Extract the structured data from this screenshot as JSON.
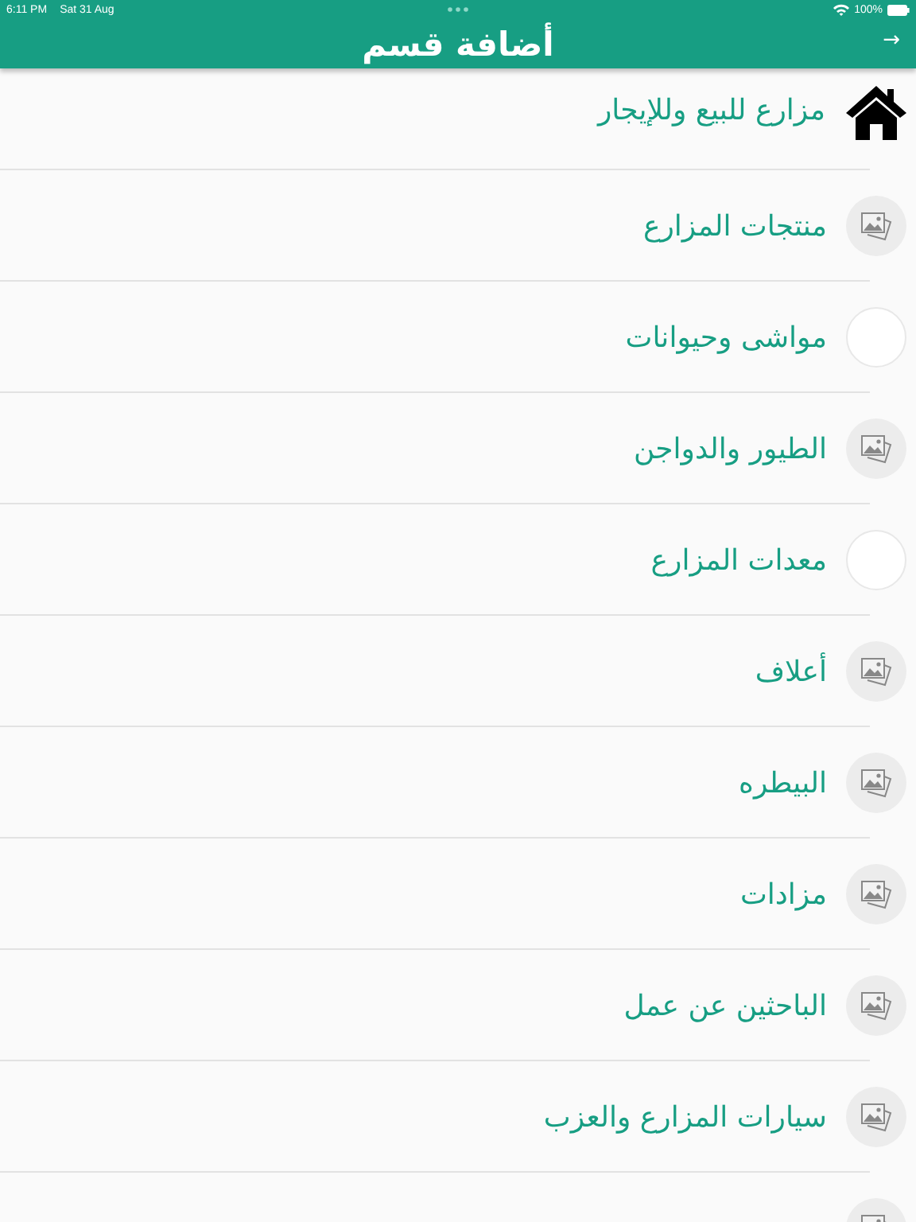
{
  "status_bar": {
    "time": "6:11 PM",
    "date": "Sat 31 Aug",
    "battery": "100%"
  },
  "header": {
    "title": "أضافة قسم",
    "back": "→"
  },
  "categories": [
    {
      "label": "مزارع للبيع وللإيجار",
      "kind": "home"
    },
    {
      "label": "منتجات المزارع",
      "kind": "image"
    },
    {
      "label": "مواشى وحيوانات",
      "kind": "blank"
    },
    {
      "label": "الطيور والدواجن",
      "kind": "image"
    },
    {
      "label": "معدات المزارع",
      "kind": "blank"
    },
    {
      "label": "أعلاف",
      "kind": "image"
    },
    {
      "label": "البيطره",
      "kind": "image"
    },
    {
      "label": "مزادات",
      "kind": "image"
    },
    {
      "label": "الباحثين عن عمل",
      "kind": "image"
    },
    {
      "label": "سيارات المزارع والعزب",
      "kind": "image"
    },
    {
      "kind": "image"
    }
  ]
}
